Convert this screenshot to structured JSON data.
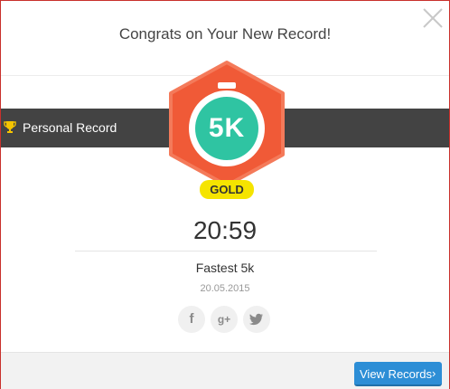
{
  "header": {
    "title": "Congrats on Your New Record!"
  },
  "band": {
    "label": "Personal Record"
  },
  "badge": {
    "distance": "5K",
    "medal": "GOLD",
    "colors": {
      "hexagon": "#f05a37",
      "circle": "#2fc4a2",
      "medal": "#f5e400"
    }
  },
  "record": {
    "time": "20:59",
    "description": "Fastest 5k",
    "date": "20.05.2015"
  },
  "share": {
    "icons": [
      "facebook-icon",
      "google-plus-icon",
      "twitter-icon"
    ],
    "facebook_glyph": "f",
    "google_glyph": "g+"
  },
  "footer": {
    "button_label": "View Records",
    "button_chevron": "›",
    "button_color": "#2d8ed6"
  },
  "close_icon": "close-icon"
}
